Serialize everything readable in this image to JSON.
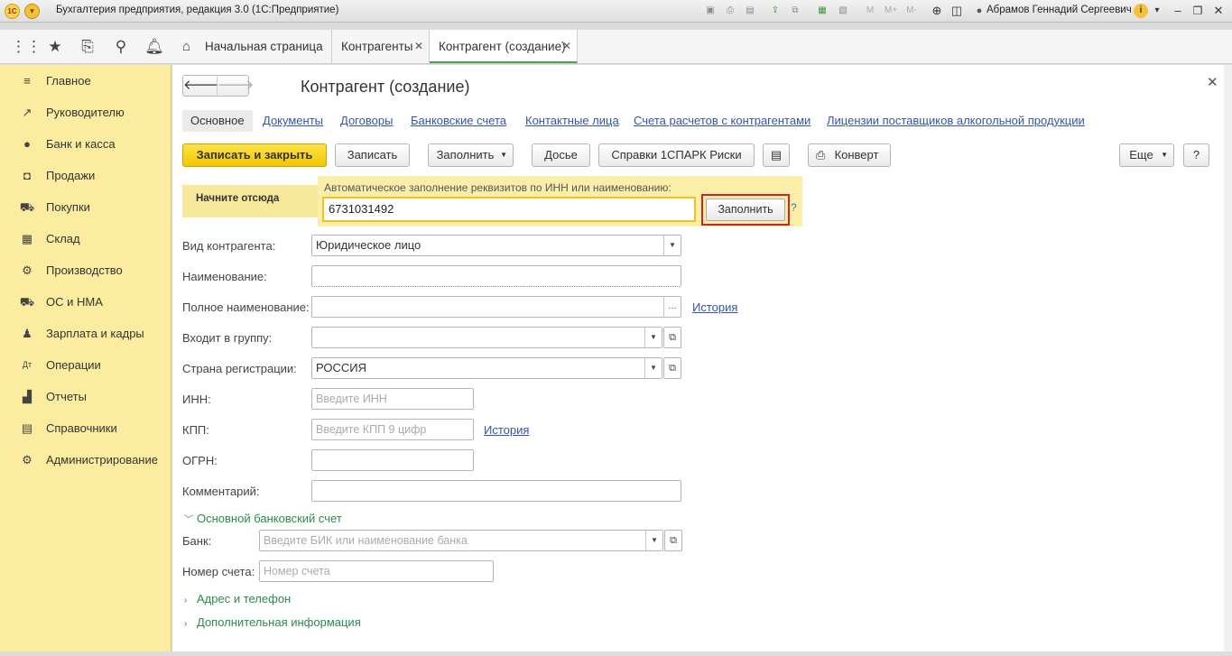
{
  "titlebar": {
    "title": "Бухгалтерия предприятия, редакция 3.0  (1С:Предприятие)",
    "user": "Абрамов Геннадий Сергеевич",
    "m": "M",
    "mplus": "M+",
    "mminus": "M-",
    "logo": "1С"
  },
  "tabs": [
    {
      "label": "Начальная страница"
    },
    {
      "label": "Контрагенты"
    },
    {
      "label": "Контрагент (создание)"
    }
  ],
  "sidebar": {
    "items": [
      {
        "label": "Главное"
      },
      {
        "label": "Руководителю"
      },
      {
        "label": "Банк и касса"
      },
      {
        "label": "Продажи"
      },
      {
        "label": "Покупки"
      },
      {
        "label": "Склад"
      },
      {
        "label": "Производство"
      },
      {
        "label": "ОС и НМА"
      },
      {
        "label": "Зарплата и кадры"
      },
      {
        "label": "Операции"
      },
      {
        "label": "Отчеты"
      },
      {
        "label": "Справочники"
      },
      {
        "label": "Администрирование"
      }
    ]
  },
  "form": {
    "title": "Контрагент (создание)",
    "sections": [
      "Основное",
      "Документы",
      "Договоры",
      "Банковские счета",
      "Контактные лица",
      "Счета расчетов с контрагентами",
      "Лицензии поставщиков алкогольной продукции"
    ],
    "buttons": {
      "save_close": "Записать и закрыть",
      "save": "Записать",
      "fill": "Заполнить",
      "dossier": "Досье",
      "spark": "Справки 1СПАРК Риски",
      "envelope": "Конверт",
      "more": "Еще",
      "help": "?"
    },
    "hint": "Начните отсюда",
    "auto": {
      "label": "Автоматическое заполнение реквизитов по ИНН или наименованию:",
      "value": "6731031492",
      "button": "Заполнить",
      "help": "?"
    },
    "fields": {
      "kind_label": "Вид контрагента:",
      "kind_value": "Юридическое лицо",
      "name_label": "Наименование:",
      "name_value": "",
      "fullname_label": "Полное наименование:",
      "fullname_value": "",
      "history": "История",
      "group_label": "Входит в группу:",
      "group_value": "",
      "country_label": "Страна регистрации:",
      "country_value": "РОССИЯ",
      "inn_label": "ИНН:",
      "inn_placeholder": "Введите ИНН",
      "kpp_label": "КПП:",
      "kpp_placeholder": "Введите КПП 9 цифр",
      "kpp_history": "История",
      "ogrn_label": "ОГРН:",
      "comment_label": "Комментарий:",
      "bank_group": "Основной банковский счет",
      "bank_label": "Банк:",
      "bank_placeholder": "Введите БИК или наименование банка",
      "account_label": "Номер счета:",
      "account_placeholder": "Номер счета",
      "address_group": "Адрес и телефон",
      "extra_group": "Дополнительная информация"
    }
  }
}
